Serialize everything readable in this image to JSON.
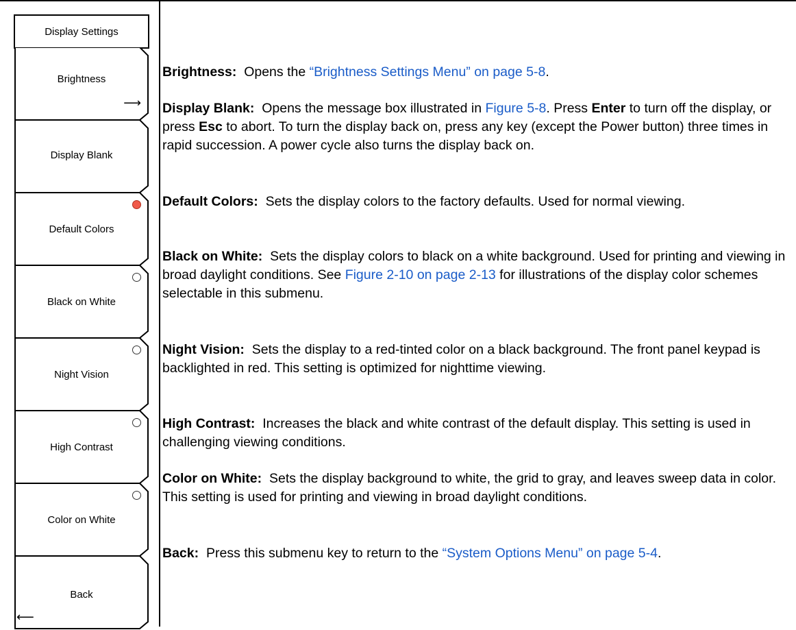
{
  "menu": {
    "title": "Display Settings",
    "keys": [
      {
        "label": "Brightness",
        "indicator": "submenu-arrow"
      },
      {
        "label": "Display Blank",
        "indicator": "none"
      },
      {
        "label": "Default Colors",
        "indicator": "radio-selected"
      },
      {
        "label": "Black on White",
        "indicator": "radio"
      },
      {
        "label": "Night Vision",
        "indicator": "radio"
      },
      {
        "label": "High Contrast",
        "indicator": "radio"
      },
      {
        "label": "Color on White",
        "indicator": "radio"
      },
      {
        "label": "Back",
        "indicator": "back-arrow"
      }
    ]
  },
  "descriptions": {
    "brightness": {
      "term": "Brightness:",
      "text1": "Opens the ",
      "link": "“Brightness Settings Menu” on page 5-8",
      "text2": "."
    },
    "display_blank": {
      "term": "Display Blank:",
      "text1": "Opens the message box illustrated in ",
      "link": "Figure 5-8",
      "text2": ". Press ",
      "enter": "Enter",
      "text3": " to turn off the display, or press ",
      "esc": "Esc",
      "text4": " to abort. To turn the display back on, press any key (except the Power button) three times in rapid succession. A power cycle also turns the display back on."
    },
    "default_colors": {
      "term": "Default Colors:",
      "text": "Sets the display colors to the factory defaults. Used for normal viewing."
    },
    "black_on_white": {
      "term": "Black on White:",
      "text1": "Sets the display colors to black on a white background. Used for printing and viewing in broad daylight conditions. See ",
      "link": "Figure 2-10 on page 2-13",
      "text2": " for illustrations of the display color schemes selectable in this submenu."
    },
    "night_vision": {
      "term": "Night Vision:",
      "text": "Sets the display to a red-tinted color on a black background. The front panel keypad is backlighted in red. This setting is optimized for nighttime viewing."
    },
    "high_contrast": {
      "term": "High Contrast:",
      "text": "Increases the black and white contrast of the default display. This setting is used in challenging viewing conditions."
    },
    "color_on_white": {
      "term": "Color on White:",
      "text": "Sets the display background to white, the grid to gray, and leaves sweep data in color. This setting is used for printing and viewing in broad daylight conditions."
    },
    "back": {
      "term": "Back:",
      "text1": "Press this submenu key to return to the ",
      "link": "“System Options Menu” on page 5-4",
      "text2": "."
    }
  },
  "colors": {
    "link": "#1a5cc8",
    "radio_selected": "#f05a4a"
  }
}
